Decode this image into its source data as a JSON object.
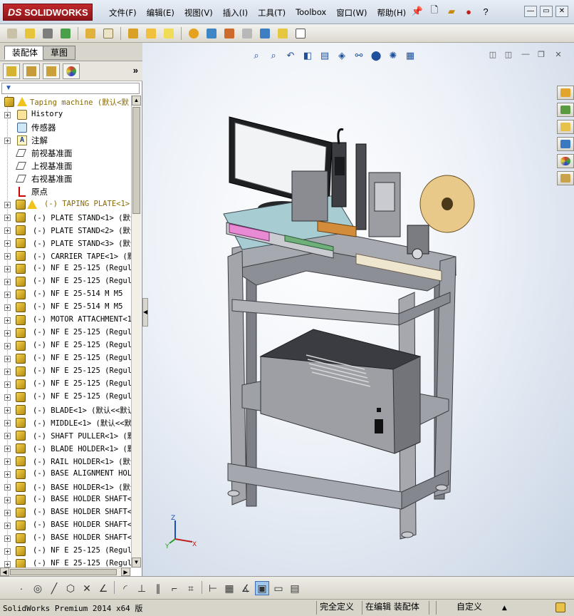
{
  "app": {
    "logo_prefix": "DS",
    "logo_text": "SOLIDWORKS"
  },
  "menu": [
    "文件(F)",
    "编辑(E)",
    "视图(V)",
    "插入(I)",
    "工具(T)",
    "Toolbox",
    "窗口(W)",
    "帮助(H)"
  ],
  "title_tools": {
    "help_glyph": "?"
  },
  "window_controls": {
    "minimize": "—",
    "restore": "▭",
    "close": "✕"
  },
  "toolbar_icons": [
    "assembly-icon",
    "insert-component-icon",
    "mate-icon",
    "linear-pattern-icon",
    "smart-fasteners-icon",
    "move-component-icon",
    "show-hidden-icon",
    "assembly-features-icon",
    "reference-geometry-icon",
    "new-motion-icon",
    "bill-of-materials-icon",
    "exploded-view-icon",
    "explode-line-icon",
    "interference-icon",
    "clearance-icon",
    "hole-alignment-icon"
  ],
  "left_panel": {
    "tabs": {
      "assembly": "装配体",
      "sketch": "草图"
    },
    "filter_glyph": "▼",
    "more_glyph": "»",
    "tree": [
      {
        "type": "root",
        "text": "Taping machine  (默认<默"
      },
      {
        "type": "history",
        "text": "History"
      },
      {
        "type": "sensor",
        "text": "传感器"
      },
      {
        "type": "note",
        "text": "注解"
      },
      {
        "type": "plane",
        "text": "前视基准面"
      },
      {
        "type": "plane",
        "text": "上视基准面"
      },
      {
        "type": "plane",
        "text": "右视基准面"
      },
      {
        "type": "origin",
        "text": "原点"
      },
      {
        "type": "warn",
        "text": "(-) TAPING PLATE<1>"
      },
      {
        "type": "part",
        "text": "(-) PLATE STAND<1> (默认"
      },
      {
        "type": "part",
        "text": "(-) PLATE STAND<2> (默认"
      },
      {
        "type": "part",
        "text": "(-) PLATE STAND<3> (默认"
      },
      {
        "type": "part",
        "text": "(-) CARRIER TAPE<1> (默"
      },
      {
        "type": "part",
        "text": "(-) NF E 25-125  (Regul"
      },
      {
        "type": "part",
        "text": "(-) NF E 25-125  (Regul"
      },
      {
        "type": "part",
        "text": "(-) NF E 25-514  M M5"
      },
      {
        "type": "part",
        "text": "(-) NF E 25-514  M M5"
      },
      {
        "type": "part",
        "text": "(-) MOTOR ATTACHMENT<1>"
      },
      {
        "type": "part",
        "text": "(-) NF E 25-125  (Regul"
      },
      {
        "type": "part",
        "text": "(-) NF E 25-125  (Regul"
      },
      {
        "type": "part",
        "text": "(-) NF E 25-125  (Regul"
      },
      {
        "type": "part",
        "text": "(-) NF E 25-125  (Regul"
      },
      {
        "type": "part",
        "text": "(-) NF E 25-125  (Regul"
      },
      {
        "type": "part",
        "text": "(-) NF E 25-125  (Regul"
      },
      {
        "type": "part",
        "text": "(-) BLADE<1> (默认<<默认"
      },
      {
        "type": "part",
        "text": "(-) MIDDLE<1> (默认<<默"
      },
      {
        "type": "part",
        "text": "(-) SHAFT PULLER<1> (默"
      },
      {
        "type": "part",
        "text": "(-) BLADE HOLDER<1> (默"
      },
      {
        "type": "part",
        "text": "(-) RAIL HOLDER<1> (默认"
      },
      {
        "type": "part",
        "text": "(-) BASE ALIGNMENT HOLD"
      },
      {
        "type": "part",
        "text": "(-) BASE HOLDER<1> (默认"
      },
      {
        "type": "part",
        "text": "(-) BASE HOLDER SHAFT<1"
      },
      {
        "type": "part",
        "text": "(-) BASE HOLDER SHAFT<2"
      },
      {
        "type": "part",
        "text": "(-) BASE HOLDER SHAFT<3"
      },
      {
        "type": "part",
        "text": "(-) BASE HOLDER SHAFT<4"
      },
      {
        "type": "part",
        "text": "(-) NF E 25-125  (Regul"
      },
      {
        "type": "part",
        "text": "(-) NF E 25-125  (Regul"
      }
    ]
  },
  "viewport": {
    "triad": {
      "x": "X",
      "y": "Y",
      "z": "Z"
    }
  },
  "status_bar": {
    "version": "SolidWorks Premium 2014 x64 版",
    "fully_defined": "完全定义",
    "editing": "在编辑 装配体",
    "units": "自定义",
    "units_caret": "▲"
  },
  "colors": {
    "brand_red": "#b3151b",
    "frame_gray": "#a0a2a8",
    "dark_frame": "#4a4c52",
    "accent_blue": "#1d4f9c"
  }
}
